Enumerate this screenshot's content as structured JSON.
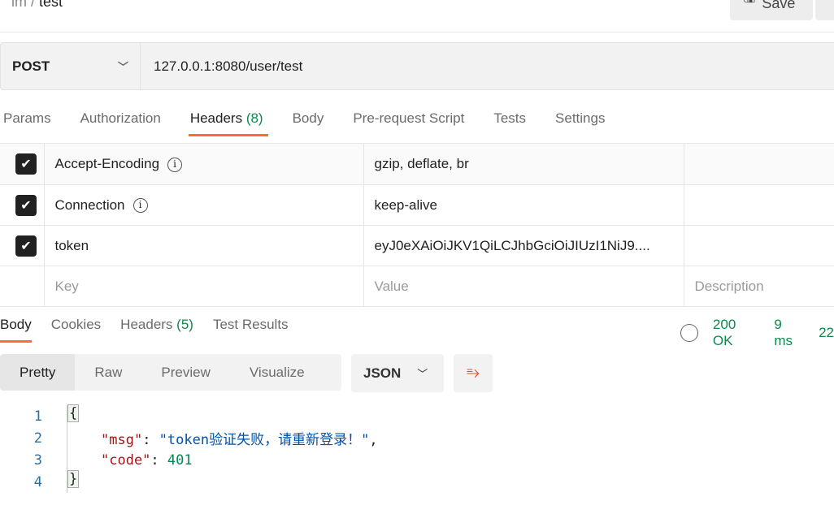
{
  "breadcrumb": {
    "parent": "lm",
    "separator": "/",
    "current": "test"
  },
  "save_label": "Save",
  "request": {
    "method": "POST",
    "url": "127.0.0.1:8080/user/test"
  },
  "tabs": [
    {
      "label": "Params"
    },
    {
      "label": "Authorization"
    },
    {
      "label": "Headers",
      "count": "(8)"
    },
    {
      "label": "Body"
    },
    {
      "label": "Pre-request Script"
    },
    {
      "label": "Tests"
    },
    {
      "label": "Settings"
    }
  ],
  "headers": [
    {
      "key": "Accept-Encoding",
      "value": "gzip, deflate, br",
      "checked": true
    },
    {
      "key": "Connection",
      "value": "keep-alive",
      "checked": true
    },
    {
      "key": "token",
      "value": "eyJ0eXAiOiJKV1QiLCJhbGciOiJIUzI1NiJ9....",
      "checked": true
    }
  ],
  "placeholders": {
    "key": "Key",
    "value": "Value",
    "description": "Description"
  },
  "response": {
    "tabs": [
      {
        "label": "Body"
      },
      {
        "label": "Cookies"
      },
      {
        "label": "Headers",
        "count": "(5)"
      },
      {
        "label": "Test Results"
      }
    ],
    "status": "200 OK",
    "time": "9 ms",
    "size": "22",
    "views": [
      "Pretty",
      "Raw",
      "Preview",
      "Visualize"
    ],
    "format": "JSON",
    "lines": [
      "1",
      "2",
      "3",
      "4"
    ],
    "body": {
      "open": "{",
      "msg_key": "\"msg\"",
      "msg_val": "\"token验证失败，请重新登录！\"",
      "code_key": "\"code\"",
      "code_val": "401",
      "close": "}"
    }
  },
  "colors": {
    "accent": "#ff6c37",
    "success": "#0c8a4a"
  }
}
